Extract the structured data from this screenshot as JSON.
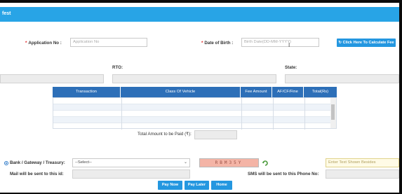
{
  "header": {
    "title": "fest"
  },
  "form": {
    "app_no_label": "Application No :",
    "app_no_placeholder": "Application No",
    "dob_label": "Date of Birth :",
    "dob_placeholder": "Birth Date(DD-MM-YYYY)",
    "calc_fee_label": "Click Here To Calculate Fee",
    "rto_label": "RTO:",
    "state_label": "State:"
  },
  "fee_table": {
    "columns": [
      "Transaction",
      "Class Of Vehicle",
      "Fee Amount",
      "AF/CF/Fine",
      "Total(Rs)"
    ]
  },
  "total": {
    "label": "Total Amount to be Paid (₹):"
  },
  "payment": {
    "mode_label": "Bank / Gateway / Treasury:",
    "select_value": "--Select--",
    "captcha_text": "RBM35Y",
    "captcha_input_placeholder": "Enter Text Shown Besides",
    "mail_label": "Mail will be sent to this id:",
    "sms_label": "SMS will be sent to this Phone No:"
  },
  "actions": {
    "pay_now": "Pay Now",
    "pay_later": "Pay Later",
    "home": "Home"
  },
  "colors": {
    "header": "#28a4e6",
    "table_header": "#2d6fb8",
    "button": "#2497e0",
    "captcha_bg": "#f4b4a6"
  }
}
